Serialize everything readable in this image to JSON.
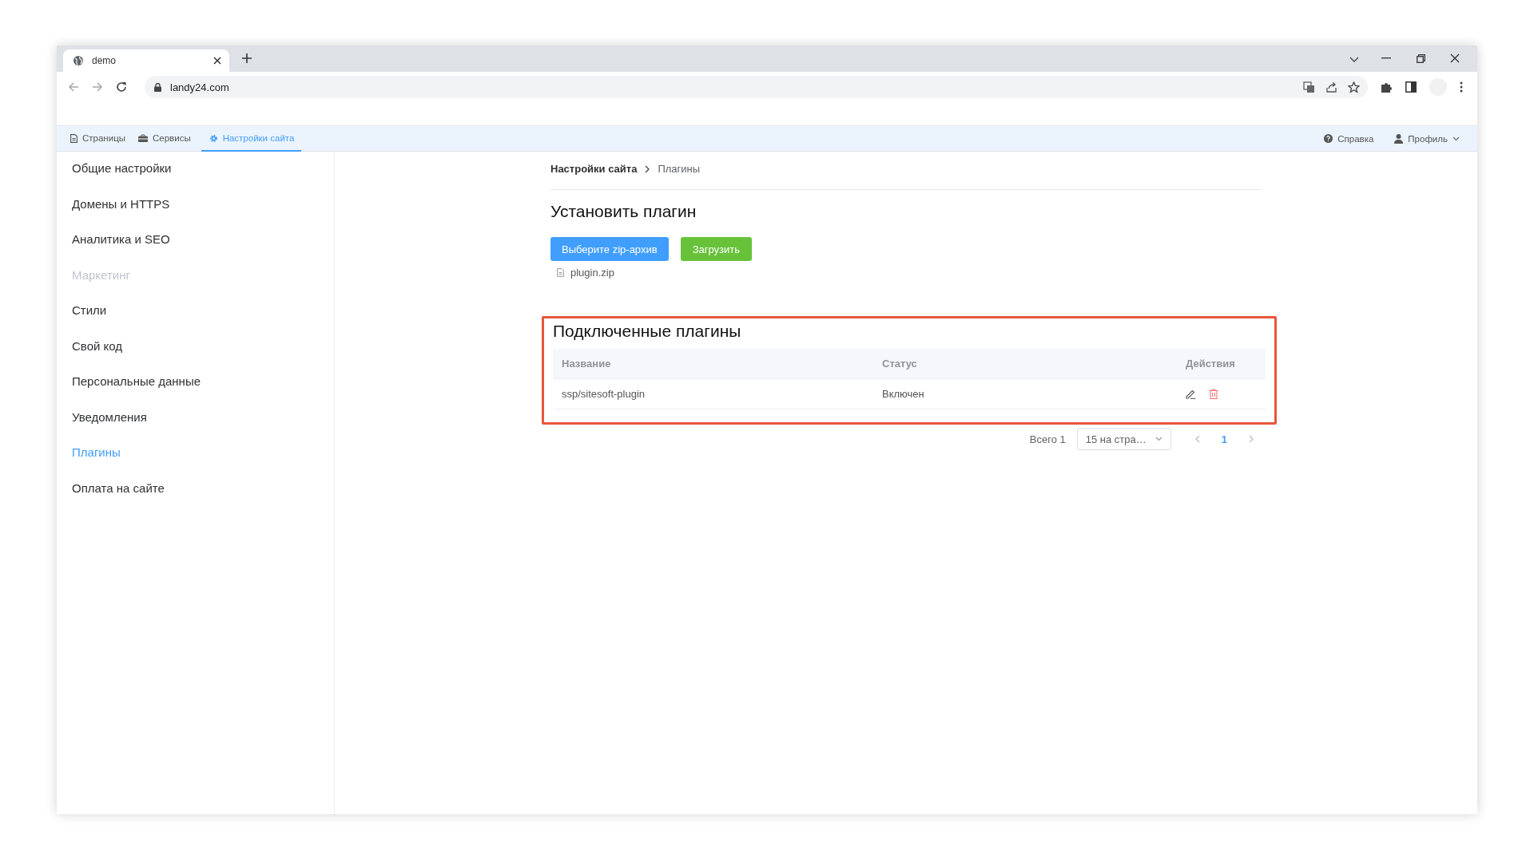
{
  "browser": {
    "tab_title": "demo",
    "url": "landy24.com"
  },
  "top_nav": {
    "tabs": [
      {
        "label": "Страницы",
        "selected": false
      },
      {
        "label": "Сервисы",
        "selected": false
      },
      {
        "label": "Настройки сайта",
        "selected": true
      }
    ],
    "help": "Справка",
    "profile": "Профиль"
  },
  "sidebar": {
    "items": [
      {
        "label": "Общие настройки",
        "selected": false,
        "disabled": false
      },
      {
        "label": "Домены и HTTPS",
        "selected": false,
        "disabled": false
      },
      {
        "label": "Аналитика и SEO",
        "selected": false,
        "disabled": false
      },
      {
        "label": "Маркетинг",
        "selected": false,
        "disabled": true
      },
      {
        "label": "Стили",
        "selected": false,
        "disabled": false
      },
      {
        "label": "Свой код",
        "selected": false,
        "disabled": false
      },
      {
        "label": "Персональные данные",
        "selected": false,
        "disabled": false
      },
      {
        "label": "Уведомления",
        "selected": false,
        "disabled": false
      },
      {
        "label": "Плагины",
        "selected": true,
        "disabled": false
      },
      {
        "label": "Оплата на сайте",
        "selected": false,
        "disabled": false
      }
    ]
  },
  "breadcrumb": [
    "Настройки сайта",
    "Плагины"
  ],
  "install": {
    "title": "Установить плагин",
    "choose_button": "Выберите zip-архив",
    "upload_button": "Загрузить",
    "file_name": "plugin.zip"
  },
  "plugins": {
    "title": "Подключенные плагины",
    "highlighted": true,
    "columns": [
      "Название",
      "Статус",
      "Действия"
    ],
    "rows": [
      {
        "name": "ssp/sitesoft-plugin",
        "status": "Включен"
      }
    ]
  },
  "pagination": {
    "total": "Всего 1",
    "page_size": "15 на стра…",
    "pages": [
      {
        "label": "1",
        "selected": true
      }
    ]
  }
}
